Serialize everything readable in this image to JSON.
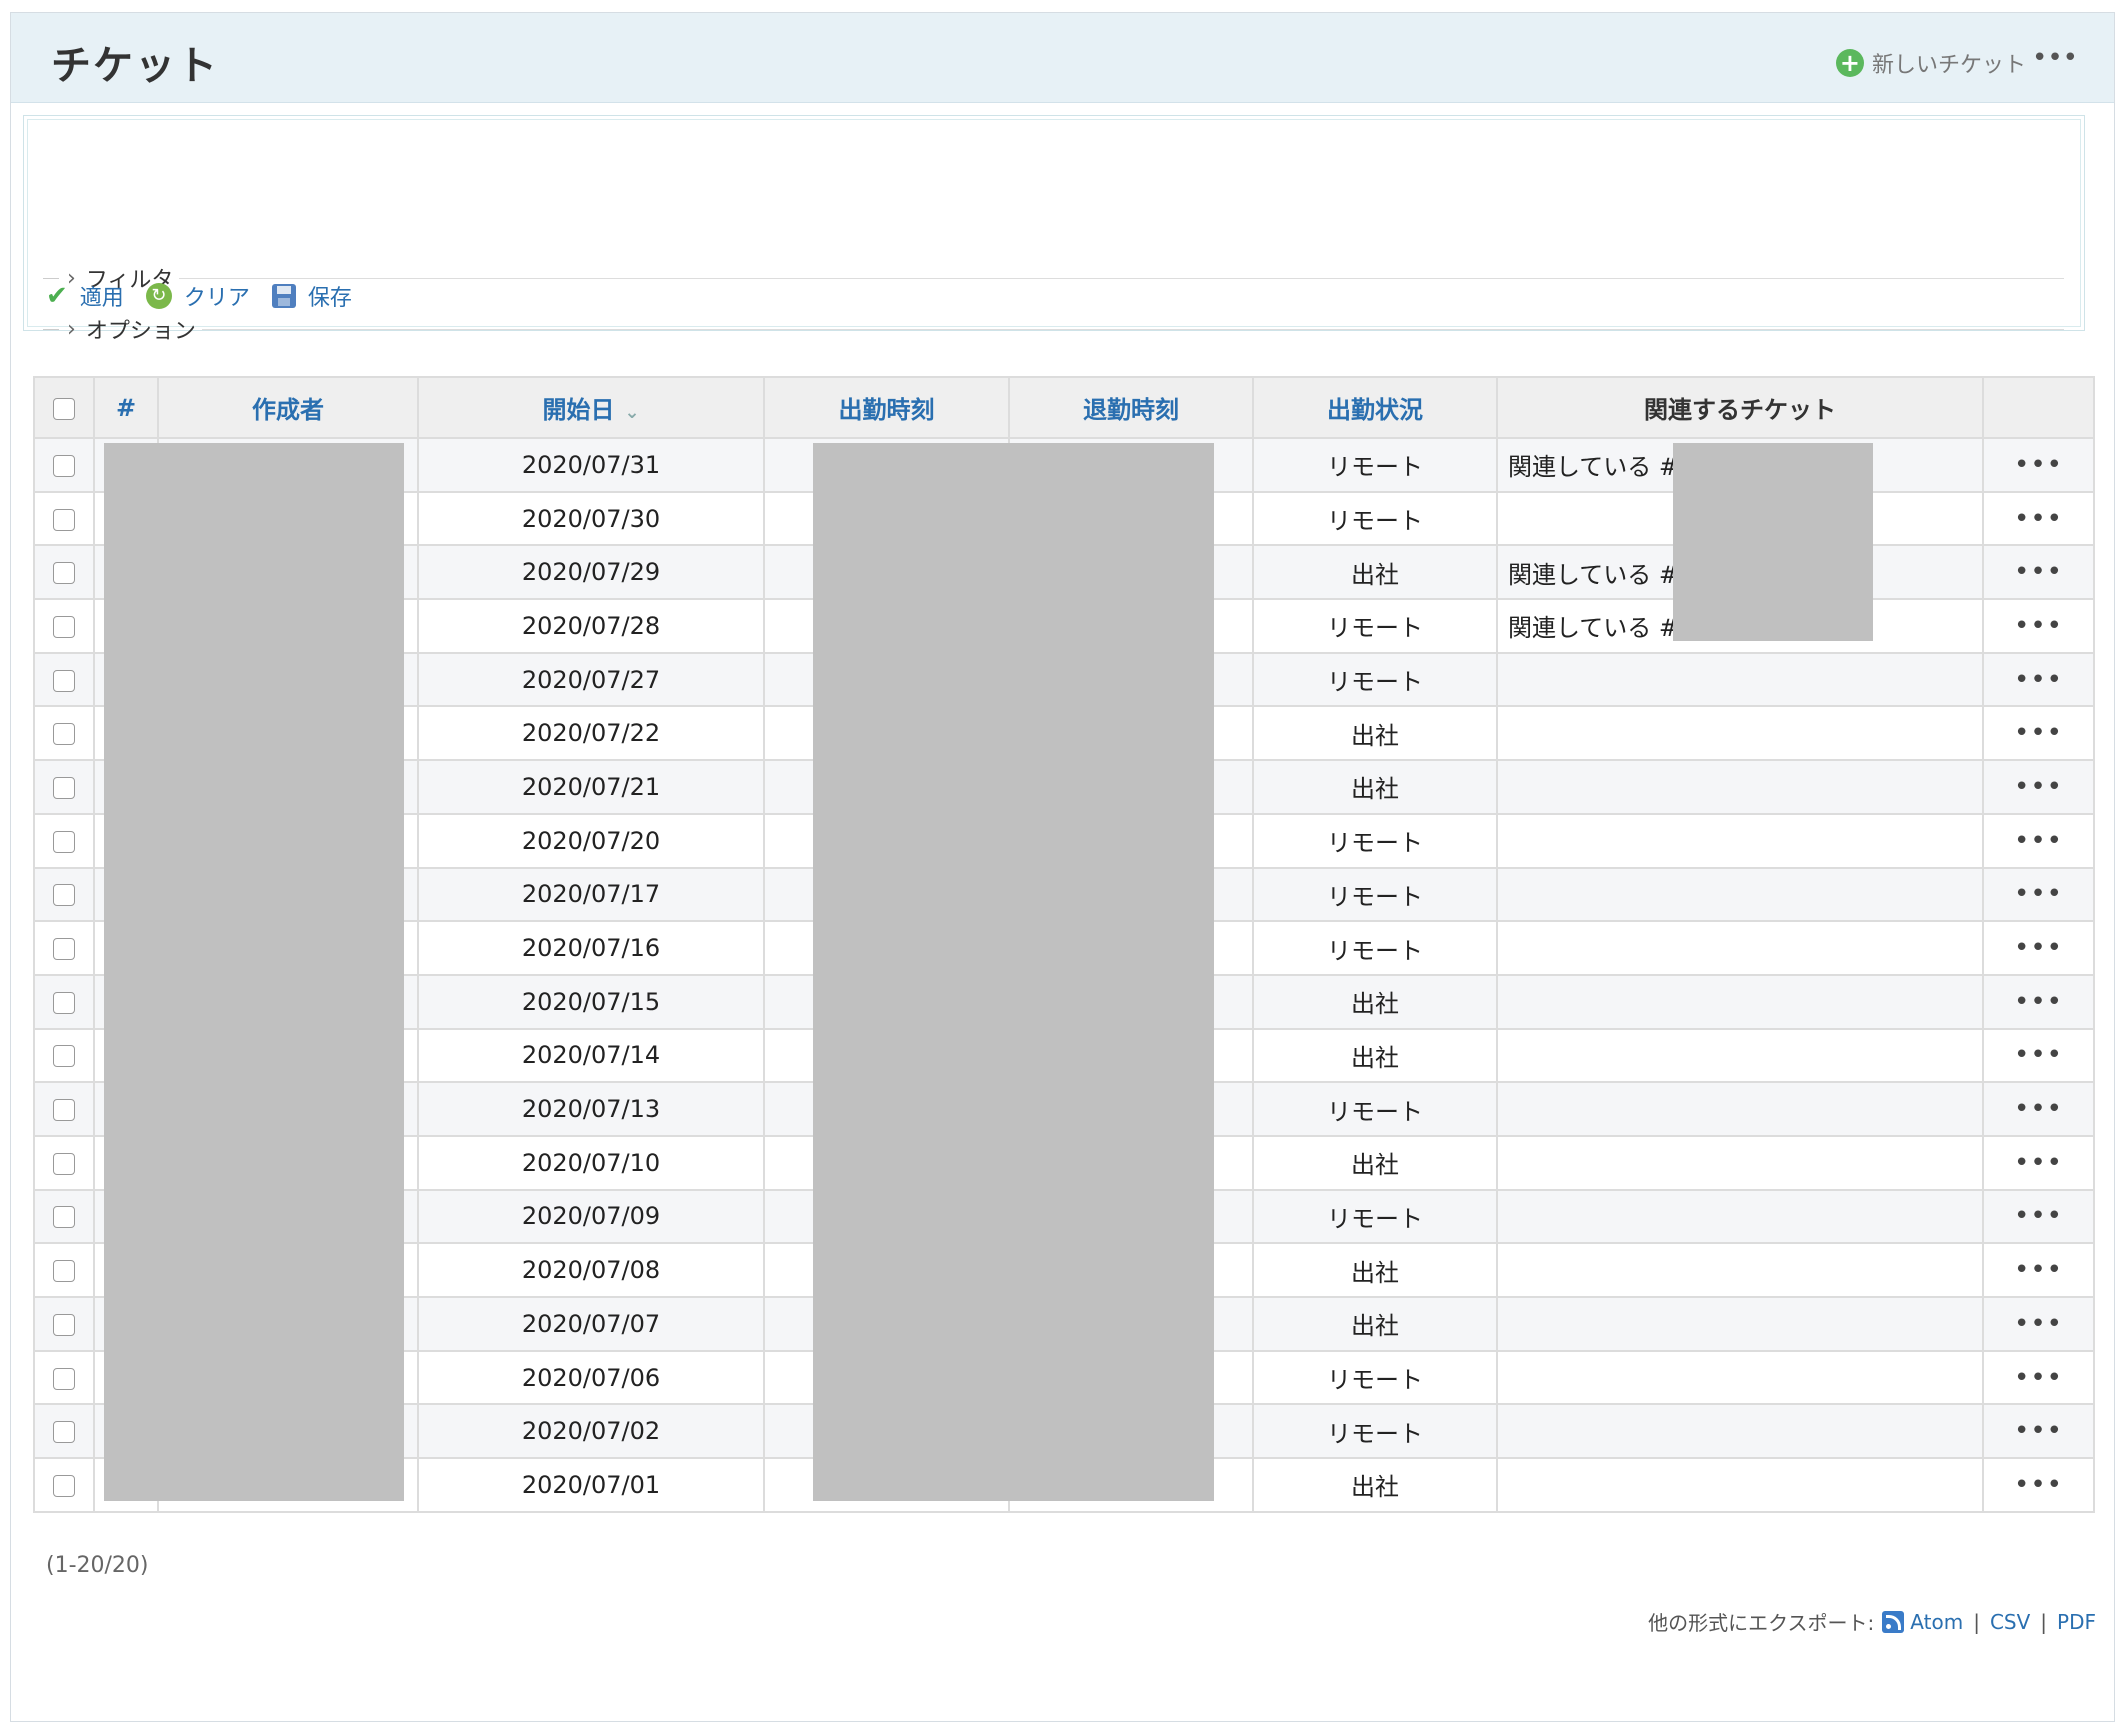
{
  "header": {
    "title": "チケット",
    "new_ticket_label": "新しいチケット",
    "more": "•••"
  },
  "query": {
    "filter_label": "フィルタ",
    "options_label": "オプション",
    "apply_label": "適用",
    "clear_label": "クリア",
    "save_label": "保存"
  },
  "table": {
    "columns": {
      "id": "#",
      "author": "作成者",
      "start_date": "開始日",
      "clock_in": "出勤時刻",
      "clock_out": "退勤時刻",
      "attendance": "出勤状況",
      "related": "関連するチケット"
    },
    "rows": [
      {
        "date": "2020/07/31",
        "status": "リモート",
        "related": "関連している #"
      },
      {
        "date": "2020/07/30",
        "status": "リモート",
        "related": ""
      },
      {
        "date": "2020/07/29",
        "status": "出社",
        "related": "関連している #"
      },
      {
        "date": "2020/07/28",
        "status": "リモート",
        "related": "関連している #"
      },
      {
        "date": "2020/07/27",
        "status": "リモート",
        "related": ""
      },
      {
        "date": "2020/07/22",
        "status": "出社",
        "related": ""
      },
      {
        "date": "2020/07/21",
        "status": "出社",
        "related": ""
      },
      {
        "date": "2020/07/20",
        "status": "リモート",
        "related": ""
      },
      {
        "date": "2020/07/17",
        "status": "リモート",
        "related": ""
      },
      {
        "date": "2020/07/16",
        "status": "リモート",
        "related": ""
      },
      {
        "date": "2020/07/15",
        "status": "出社",
        "related": ""
      },
      {
        "date": "2020/07/14",
        "status": "出社",
        "related": ""
      },
      {
        "date": "2020/07/13",
        "status": "リモート",
        "related": ""
      },
      {
        "date": "2020/07/10",
        "status": "出社",
        "related": ""
      },
      {
        "date": "2020/07/09",
        "status": "リモート",
        "related": ""
      },
      {
        "date": "2020/07/08",
        "status": "出社",
        "related": ""
      },
      {
        "date": "2020/07/07",
        "status": "出社",
        "related": ""
      },
      {
        "date": "2020/07/06",
        "status": "リモート",
        "related": ""
      },
      {
        "date": "2020/07/02",
        "status": "リモート",
        "related": ""
      },
      {
        "date": "2020/07/01",
        "status": "出社",
        "related": ""
      }
    ],
    "row_more": "•••"
  },
  "pagination": "(1-20/20)",
  "export": {
    "label": "他の形式にエクスポート:",
    "atom": "Atom",
    "csv": "CSV",
    "pdf": "PDF",
    "separator": "|"
  }
}
